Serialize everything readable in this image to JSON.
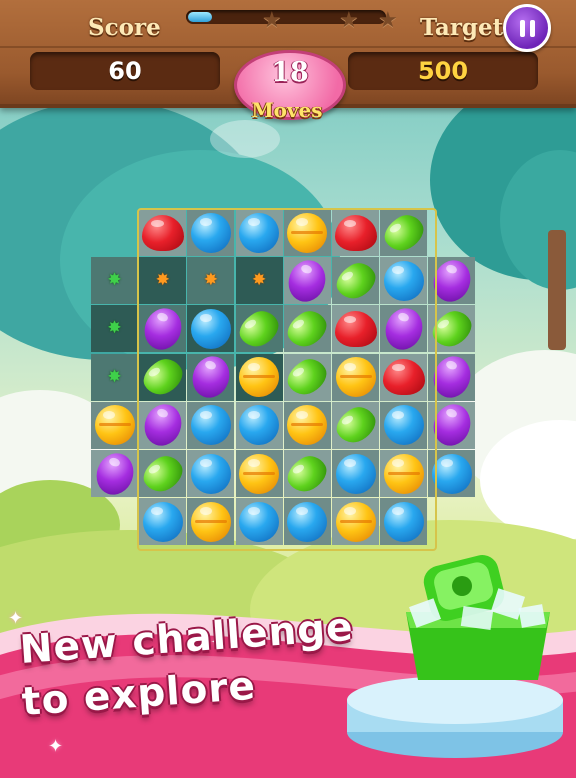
{
  "hud": {
    "score_label": "Score",
    "score_value": "60",
    "target_label": "Target",
    "target_value": "500",
    "moves_value": "18",
    "moves_label": "Moves",
    "progress_fraction": 0.12,
    "stars": [
      "star",
      "star",
      "star"
    ],
    "pause_icon": "pause-icon"
  },
  "board": {
    "cols": 8,
    "rows": 7,
    "grid": [
      [
        null,
        "red",
        "blue",
        "blue",
        "yellow",
        "red",
        "green",
        null
      ],
      [
        "gem-green",
        "gem-orange",
        "gem-orange",
        "gem-orange",
        "purple",
        "green",
        "blue",
        "purple"
      ],
      [
        "gem-green",
        "purple",
        "blue",
        "green",
        "green",
        "red",
        "purple",
        "green"
      ],
      [
        "gem-green",
        "green",
        "purple",
        "yellow",
        "green",
        "yellow",
        "red",
        "purple"
      ],
      [
        "yellow",
        "purple",
        "blue",
        "blue",
        "yellow",
        "green",
        "blue",
        "purple"
      ],
      [
        "purple",
        "green",
        "blue",
        "yellow",
        "green",
        "blue",
        "yellow",
        "blue"
      ],
      [
        null,
        "blue",
        "yellow",
        "blue",
        "blue",
        "yellow",
        "blue",
        null
      ]
    ]
  },
  "banner": {
    "line1": "New challenge",
    "line2": "to explore"
  },
  "colors": {
    "red": "#e8202a",
    "blue": "#29a8ef",
    "yellow": "#ffc414",
    "purple": "#a52de0",
    "green": "#5ed21d",
    "wood": "#9a5a2e",
    "banner_pink": "#e83a78"
  }
}
